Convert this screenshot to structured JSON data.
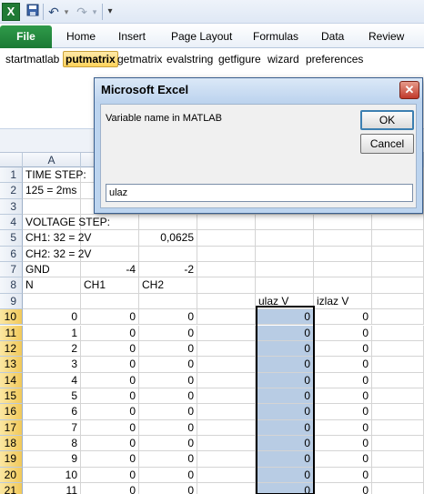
{
  "qat": {
    "app_icon": "X",
    "save_icon": "save-icon",
    "undo_icon": "undo-icon",
    "redo_icon": "redo-icon"
  },
  "tabs": {
    "file": "File",
    "items": [
      "Home",
      "Insert",
      "Page Layout",
      "Formulas",
      "Data",
      "Review"
    ]
  },
  "addin": {
    "buttons": [
      "startmatlab",
      "putmatrix",
      "getmatrix",
      "evalstring",
      "getfigure",
      "wizard",
      "preferences"
    ],
    "active": "putmatrix"
  },
  "grid": {
    "columns": [
      "A"
    ],
    "rows": [
      {
        "n": "1",
        "cells": [
          "TIME STEP:",
          "",
          "",
          "",
          "",
          ""
        ]
      },
      {
        "n": "2",
        "cells": [
          "125 = 2ms",
          "",
          "",
          "",
          "",
          ""
        ]
      },
      {
        "n": "3",
        "cells": [
          "",
          "",
          "",
          "",
          "",
          ""
        ]
      },
      {
        "n": "4",
        "cells": [
          "VOLTAGE STEP:",
          "",
          "",
          "",
          "",
          ""
        ]
      },
      {
        "n": "5",
        "cells": [
          "CH1:  32 = 2V",
          "",
          "0,0625",
          "",
          "",
          ""
        ]
      },
      {
        "n": "6",
        "cells": [
          "CH2:  32 = 2V",
          "",
          "",
          "",
          "",
          ""
        ]
      },
      {
        "n": "7",
        "cells": [
          "GND",
          "-4",
          "-2",
          "",
          "",
          ""
        ]
      },
      {
        "n": "8",
        "cells": [
          "N",
          "CH1",
          "CH2",
          "",
          "",
          ""
        ]
      },
      {
        "n": "9",
        "cells": [
          "",
          "",
          "",
          "",
          "ulaz V",
          "izlaz V"
        ]
      },
      {
        "n": "10",
        "cells": [
          "0",
          "0",
          "0",
          "",
          "0",
          "0"
        ]
      },
      {
        "n": "11",
        "cells": [
          "1",
          "0",
          "0",
          "",
          "0",
          "0"
        ]
      },
      {
        "n": "12",
        "cells": [
          "2",
          "0",
          "0",
          "",
          "0",
          "0"
        ]
      },
      {
        "n": "13",
        "cells": [
          "3",
          "0",
          "0",
          "",
          "0",
          "0"
        ]
      },
      {
        "n": "14",
        "cells": [
          "4",
          "0",
          "0",
          "",
          "0",
          "0"
        ]
      },
      {
        "n": "15",
        "cells": [
          "5",
          "0",
          "0",
          "",
          "0",
          "0"
        ]
      },
      {
        "n": "16",
        "cells": [
          "6",
          "0",
          "0",
          "",
          "0",
          "0"
        ]
      },
      {
        "n": "17",
        "cells": [
          "7",
          "0",
          "0",
          "",
          "0",
          "0"
        ]
      },
      {
        "n": "18",
        "cells": [
          "8",
          "0",
          "0",
          "",
          "0",
          "0"
        ]
      },
      {
        "n": "19",
        "cells": [
          "9",
          "0",
          "0",
          "",
          "0",
          "0"
        ]
      },
      {
        "n": "20",
        "cells": [
          "10",
          "0",
          "0",
          "",
          "0",
          "0"
        ]
      },
      {
        "n": "21",
        "cells": [
          "11",
          "0",
          "0",
          "",
          "0",
          "0"
        ]
      }
    ]
  },
  "dialog": {
    "title": "Microsoft Excel",
    "close_icon": "close-icon",
    "prompt": "Variable name in MATLAB",
    "ok": "OK",
    "cancel": "Cancel",
    "input_value": "ulaz"
  }
}
